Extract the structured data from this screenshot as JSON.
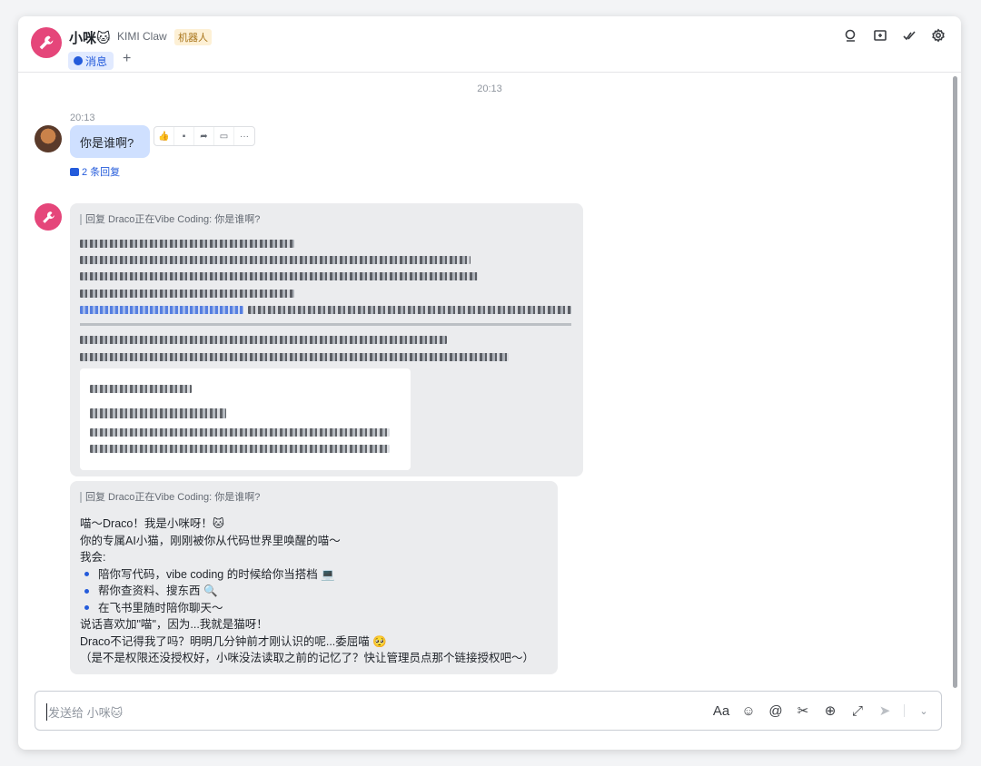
{
  "header": {
    "name": "小咪🐱",
    "org": "KIMI Claw",
    "badge": "机器人",
    "tab_label": "消息",
    "add_tab": "+"
  },
  "chat": {
    "center_time": "20:13",
    "user_msg": {
      "time": "20:13",
      "text": "你是谁啊?",
      "actions": [
        "👍",
        "▪",
        "➦",
        "▭",
        "···"
      ],
      "reply_count": "2 条回复"
    },
    "bot_reply_1": {
      "quote": "回复 Draco正在Vibe Coding: 你是谁啊?"
    },
    "bot_reply_2": {
      "quote": "回复 Draco正在Vibe Coding: 你是谁啊?",
      "lines": [
        "喵～Draco！我是小咪呀！🐱",
        "你的专属AI小猫，刚刚被你从代码世界里唤醒的喵～",
        "我会:",
        "陪你写代码，vibe coding 的时候给你当搭档 💻",
        "帮你查资料、搜东西 🔍",
        "在飞书里随时陪你聊天～",
        "说话喜欢加\"喵\"，因为...我就是猫呀！",
        "Draco不记得我了吗？明明几分钟前才刚认识的呢...委屈喵 🥺",
        "（是不是权限还没授权好，小咪没法读取之前的记忆了？快让管理员点那个链接授权吧～）"
      ]
    }
  },
  "input": {
    "placeholder": "发送给 小咪🐱",
    "tools": [
      "Aa",
      "☺",
      "@",
      "✂",
      "⊕",
      "⤢",
      "➤",
      "⌄"
    ]
  },
  "colors": {
    "accent": "#245bdb",
    "bot_avatar": "#e5467a",
    "user_bubble": "#cfe0ff",
    "bot_bubble": "#ebecee"
  }
}
